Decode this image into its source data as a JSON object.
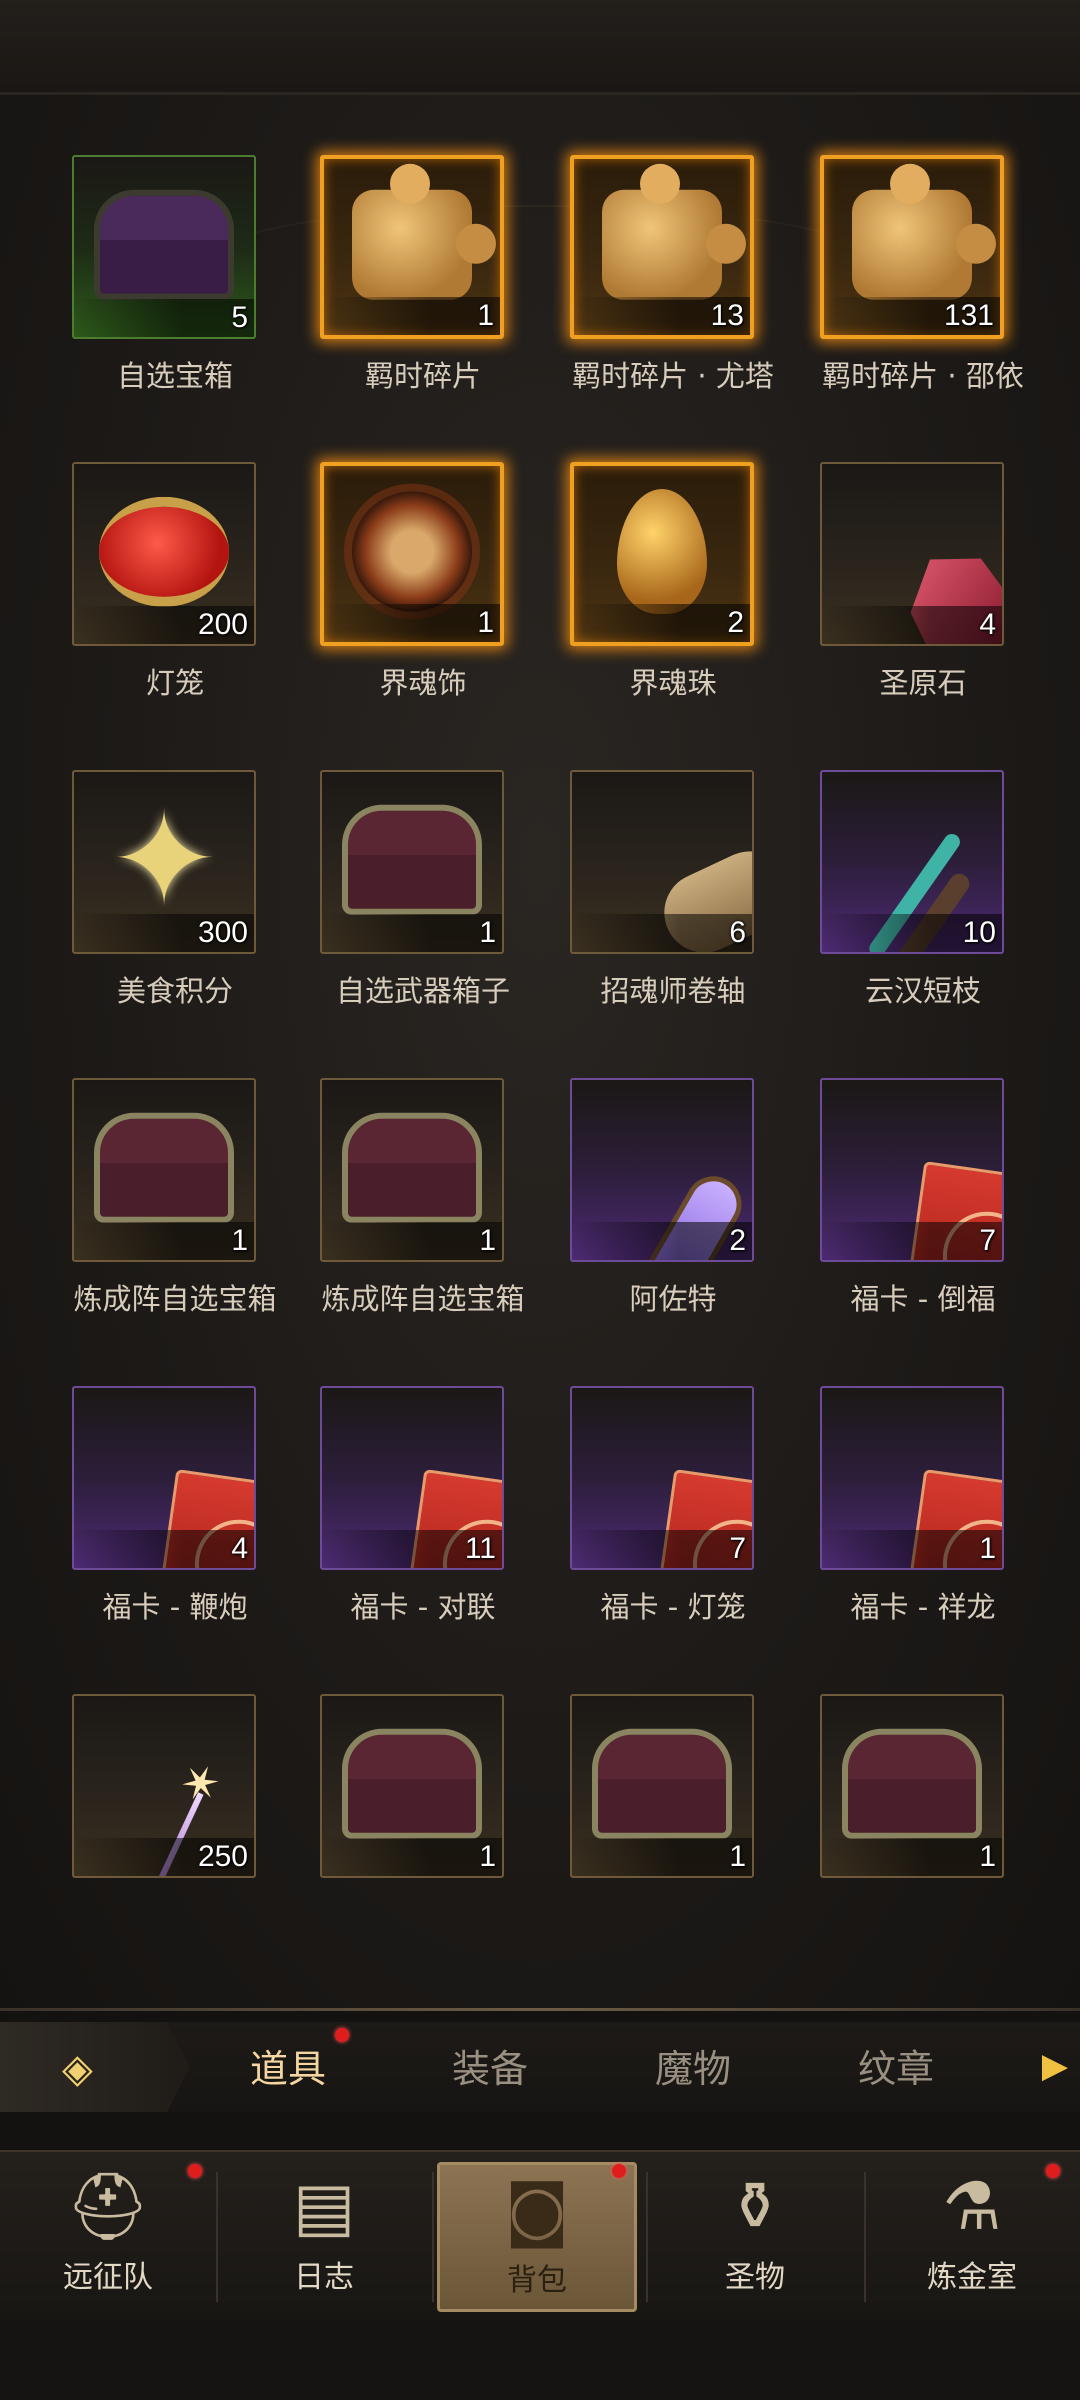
{
  "items": [
    {
      "name": "自选宝箱",
      "count": "5",
      "frame": "green",
      "icon": "purple-chest-icon"
    },
    {
      "name": "羁时碎片",
      "count": "1",
      "frame": "gold",
      "icon": "puzzle-piece-icon"
    },
    {
      "name": "羁时碎片 · 尤塔",
      "count": "13",
      "frame": "gold",
      "icon": "puzzle-piece-icon"
    },
    {
      "name": "羁时碎片 · 邵依",
      "count": "131",
      "frame": "gold",
      "icon": "puzzle-piece-icon"
    },
    {
      "name": "灯笼",
      "count": "200",
      "frame": "bronze",
      "icon": "lantern-icon"
    },
    {
      "name": "界魂饰",
      "count": "1",
      "frame": "gold",
      "icon": "sun-mask-icon"
    },
    {
      "name": "界魂珠",
      "count": "2",
      "frame": "gold",
      "icon": "golden-egg-icon"
    },
    {
      "name": "圣原石",
      "count": "4",
      "frame": "bronze",
      "icon": "red-gem-icon"
    },
    {
      "name": "美食积分",
      "count": "300",
      "frame": "bronze",
      "icon": "gold-star-icon"
    },
    {
      "name": "自选武器箱子",
      "count": "1",
      "frame": "bronze",
      "icon": "chest-icon"
    },
    {
      "name": "招魂师卷轴",
      "count": "6",
      "frame": "bronze",
      "icon": "scroll-icon"
    },
    {
      "name": "云汉短枝",
      "count": "10",
      "frame": "purple",
      "icon": "branch-icon"
    },
    {
      "name": "炼成阵自选宝箱",
      "count": "1",
      "frame": "bronze",
      "icon": "chest-icon"
    },
    {
      "name": "炼成阵自选宝箱",
      "count": "1",
      "frame": "bronze",
      "icon": "chest-icon"
    },
    {
      "name": "阿佐特",
      "count": "2",
      "frame": "purple",
      "icon": "crystal-vial-icon"
    },
    {
      "name": "福卡 - 倒福",
      "count": "7",
      "frame": "purple",
      "icon": "red-card-icon"
    },
    {
      "name": "福卡 - 鞭炮",
      "count": "4",
      "frame": "purple",
      "icon": "red-card-icon"
    },
    {
      "name": "福卡 - 对联",
      "count": "11",
      "frame": "purple",
      "icon": "red-card-icon"
    },
    {
      "name": "福卡 - 灯笼",
      "count": "7",
      "frame": "purple",
      "icon": "red-card-icon"
    },
    {
      "name": "福卡 - 祥龙",
      "count": "1",
      "frame": "purple",
      "icon": "red-card-icon"
    },
    {
      "name": "",
      "count": "250",
      "frame": "bronze",
      "icon": "firework-stick-icon"
    },
    {
      "name": "",
      "count": "1",
      "frame": "bronze",
      "icon": "chest-icon"
    },
    {
      "name": "",
      "count": "1",
      "frame": "bronze",
      "icon": "chest-icon"
    },
    {
      "name": "",
      "count": "1",
      "frame": "bronze",
      "icon": "chest-icon"
    }
  ],
  "tabs": [
    {
      "label": "道具",
      "active": true,
      "badge": true
    },
    {
      "label": "装备",
      "active": false,
      "badge": false
    },
    {
      "label": "魔物",
      "active": false,
      "badge": false
    },
    {
      "label": "纹章",
      "active": false,
      "badge": false
    }
  ],
  "nav": [
    {
      "label": "远征队",
      "icon": "viking-helmet-icon",
      "badge": true,
      "active": false
    },
    {
      "label": "日志",
      "icon": "journal-icon",
      "badge": false,
      "active": false
    },
    {
      "label": "背包",
      "icon": "backpack-icon",
      "badge": true,
      "active": true
    },
    {
      "label": "圣物",
      "icon": "relic-icon",
      "badge": false,
      "active": false
    },
    {
      "label": "炼金室",
      "icon": "alchemy-icon",
      "badge": true,
      "active": false
    }
  ],
  "colors": {
    "accent_gold": "#f0a020",
    "badge_red": "#e01d1d",
    "rare_purple": "#4d2a73",
    "uncommon_green": "#2d5a1a"
  }
}
